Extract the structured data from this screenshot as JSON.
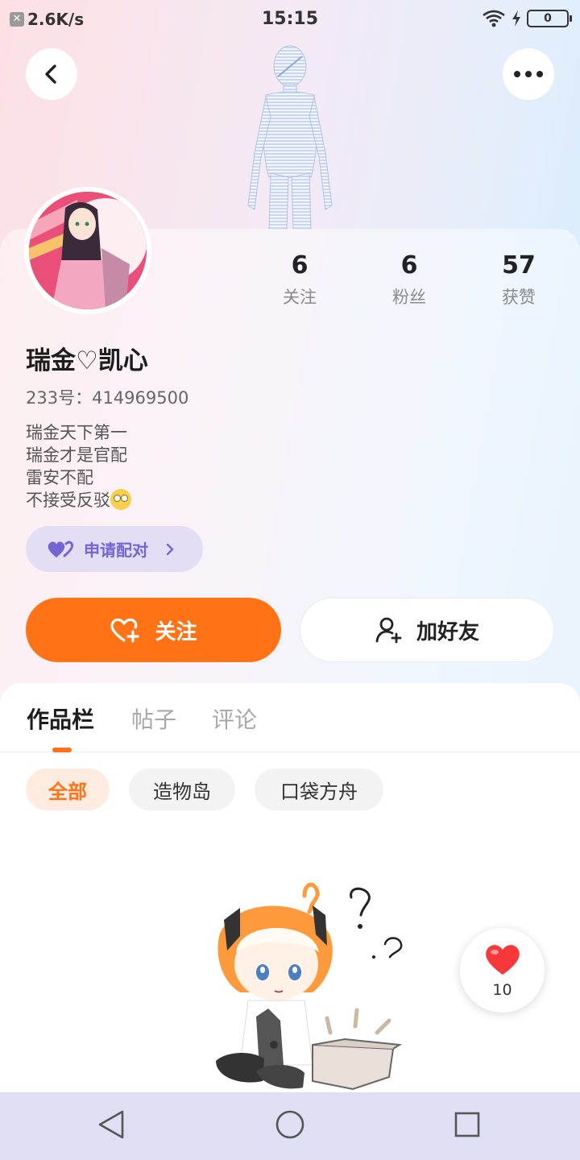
{
  "status_bar": {
    "net_speed": "2.6K/s",
    "time": "15:15",
    "battery": "0"
  },
  "profile": {
    "name": "瑞金♡凯心",
    "uid": "233号：414969500",
    "bio": [
      "瑞金天下第一",
      "瑞金才是官配",
      "雷安不配",
      "不接受反驳"
    ]
  },
  "stats": [
    {
      "value": "6",
      "label": "关注"
    },
    {
      "value": "6",
      "label": "粉丝"
    },
    {
      "value": "57",
      "label": "获赞"
    }
  ],
  "actions": {
    "pair_label": "申请配对",
    "follow_label": "关注",
    "add_friend_label": "加好友"
  },
  "tabs": [
    {
      "label": "作品栏",
      "active": true
    },
    {
      "label": "帖子",
      "active": false
    },
    {
      "label": "评论",
      "active": false
    }
  ],
  "filters": [
    {
      "label": "全部",
      "active": true
    },
    {
      "label": "造物岛",
      "active": false
    },
    {
      "label": "口袋方舟",
      "active": false
    }
  ],
  "like_widget": {
    "count": "10"
  },
  "colors": {
    "accent": "#ff7316",
    "pair_purple": "#7366d4",
    "nav_bar": "#dfdff3"
  },
  "icons": [
    "back-icon",
    "more-icon",
    "heart-plus-icon",
    "user-plus-icon",
    "double-heart-icon",
    "heart-icon",
    "nav-back-icon",
    "nav-home-icon",
    "nav-recents-icon"
  ]
}
